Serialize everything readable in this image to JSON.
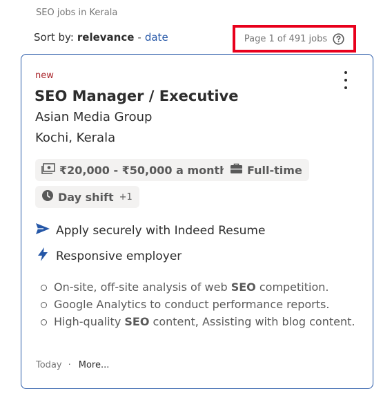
{
  "header": {
    "search_title": "SEO jobs in Kerala",
    "sort_label": "Sort by:",
    "sort_active": "relevance",
    "sort_separator": "-",
    "sort_alt": "date",
    "page_count": "Page 1 of 491 jobs",
    "help_icon": "question-circle-icon"
  },
  "card": {
    "badge": "new",
    "menu_icon": "more-vertical-icon",
    "title": "SEO Manager / Executive",
    "company": "Asian Media Group",
    "location": "Kochi, Kerala",
    "tags": {
      "salary": "₹20,000 - ₹50,000 a month",
      "job_type": "Full-time",
      "shift": "Day shift",
      "shift_extra": "+1"
    },
    "features": {
      "apply": "Apply securely with Indeed Resume",
      "responsive": "Responsive employer"
    },
    "snippet": {
      "b1_pre": "On-site, off-site analysis of web ",
      "b1_bold": "SEO",
      "b1_post": " competition.",
      "b2": "Google Analytics to conduct performance reports.",
      "b3_pre": "High-quality ",
      "b3_bold": "SEO",
      "b3_post": " content, Assisting with blog content."
    },
    "footer": {
      "posted": "Today",
      "separator": "·",
      "more": "More..."
    }
  },
  "colors": {
    "accent": "#2557a7",
    "highlight_box": "#e8001c",
    "new_badge": "#a9252b",
    "tag_bg": "#f3f2f1"
  }
}
